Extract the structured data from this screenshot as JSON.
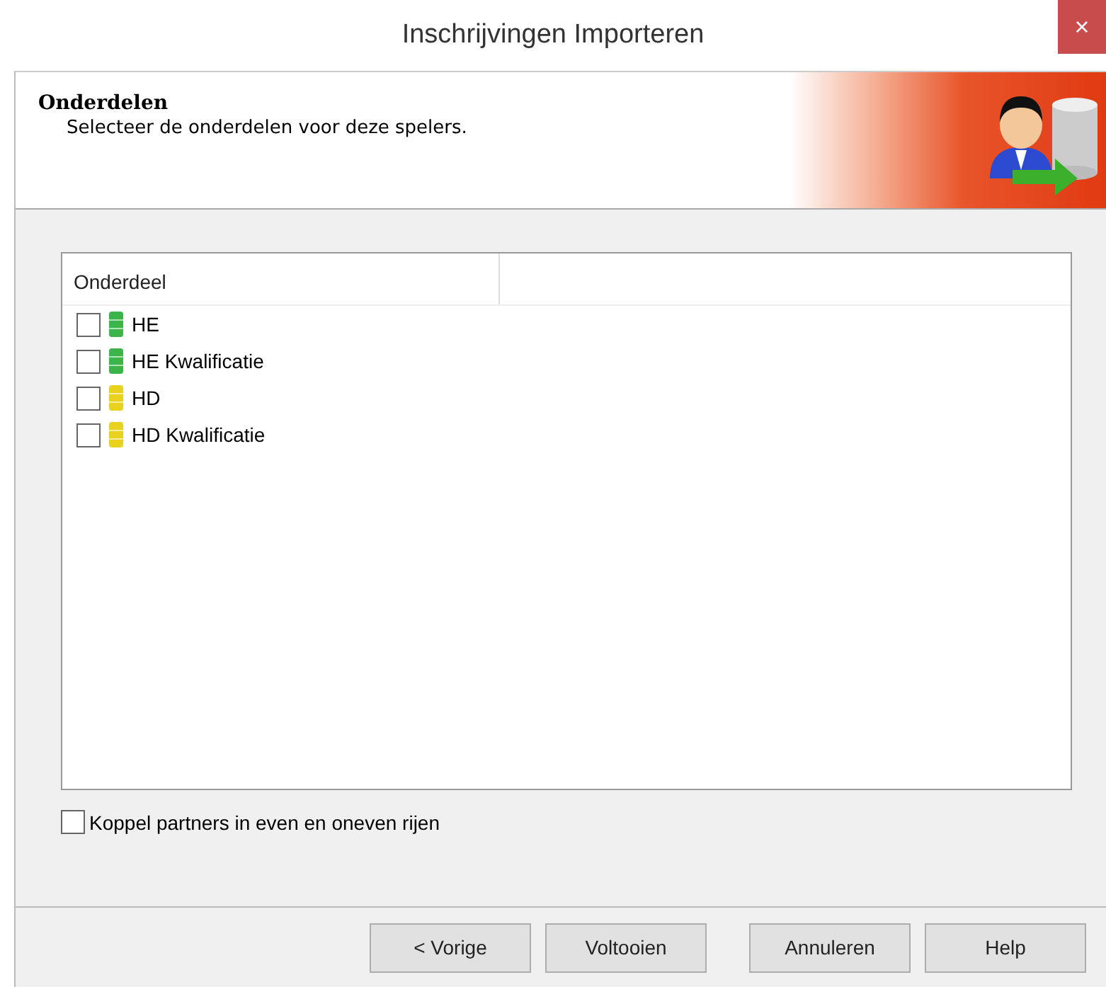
{
  "window": {
    "title": "Inschrijvingen Importeren",
    "close": "×"
  },
  "header": {
    "title": "Onderdelen",
    "subtitle": "Selecteer de onderdelen voor deze spelers."
  },
  "list": {
    "columns": [
      "Onderdeel"
    ],
    "rows": [
      {
        "label": "HE",
        "checked": false,
        "color": "#3cb44a"
      },
      {
        "label": "HE Kwalificatie",
        "checked": false,
        "color": "#3cb44a"
      },
      {
        "label": "HD",
        "checked": false,
        "color": "#e8d21e"
      },
      {
        "label": "HD Kwalificatie",
        "checked": false,
        "color": "#e8d21e"
      }
    ]
  },
  "pair_option": {
    "label": "Koppel partners in even en oneven rijen",
    "checked": false
  },
  "buttons": [
    "< Vorige",
    "Voltooien",
    "Annuleren",
    "Help"
  ]
}
